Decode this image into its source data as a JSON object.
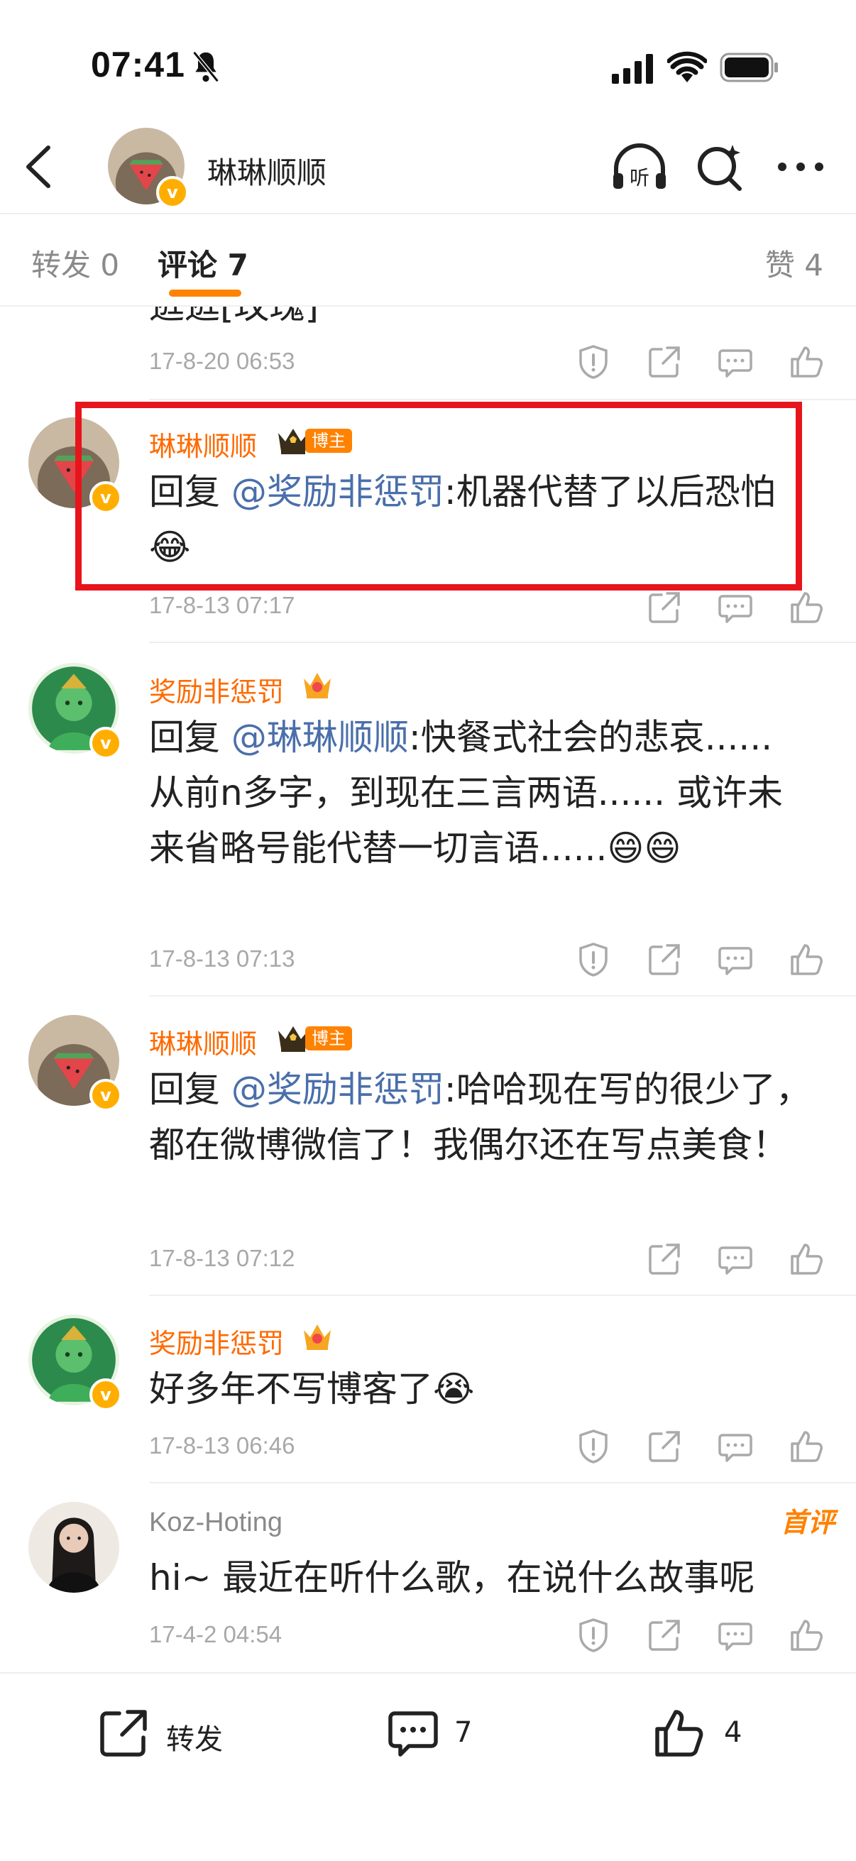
{
  "status_bar": {
    "time": "07:41"
  },
  "header": {
    "username": "琳琳顺顺"
  },
  "tabs": {
    "repost": "转发 0",
    "comments": "评论 7",
    "likes": "赞 4"
  },
  "comments": [
    {
      "id": 0,
      "text_tail": "逛逛[玫瑰]",
      "time": "17-8-20 06:53"
    },
    {
      "id": 1,
      "user": "琳琳顺顺",
      "badge": "博主",
      "reply_prefix": "回复",
      "mention": "@奖励非惩罚",
      "text": ":机器代替了以后恐怕",
      "emoji": "😂",
      "time": "17-8-13 07:17"
    },
    {
      "id": 2,
      "user": "奖励非惩罚",
      "reply_prefix": "回复",
      "mention": "@琳琳顺顺",
      "text": ":快餐式社会的悲哀...... 从前n多字，到现在三言两语...... 或许未来省略号能代替一切言语......",
      "emoji": "😄😄",
      "time": "17-8-13 07:13"
    },
    {
      "id": 3,
      "user": "琳琳顺顺",
      "badge": "博主",
      "reply_prefix": "回复",
      "mention": "@奖励非惩罚",
      "text": ":哈哈现在写的很少了，都在微博微信了！我偶尔还在写点美食！",
      "time": "17-8-13 07:12"
    },
    {
      "id": 4,
      "user": "奖励非惩罚",
      "text": "好多年不写博客了",
      "emoji": "😭",
      "time": "17-8-13 06:46"
    },
    {
      "id": 5,
      "user": "Koz-Hoting",
      "tag": "首评",
      "text": "hi~ 最近在听什么歌，在说什么故事呢",
      "time": "17-4-2 04:54"
    }
  ],
  "bottom_bar": {
    "repost_label": "转发",
    "comments_count": "7",
    "likes_count": "4"
  },
  "colors": {
    "accent": "#ff8200",
    "username": "#ff6a00",
    "mention": "#4a6faa",
    "highlight_box": "#e8141c"
  }
}
